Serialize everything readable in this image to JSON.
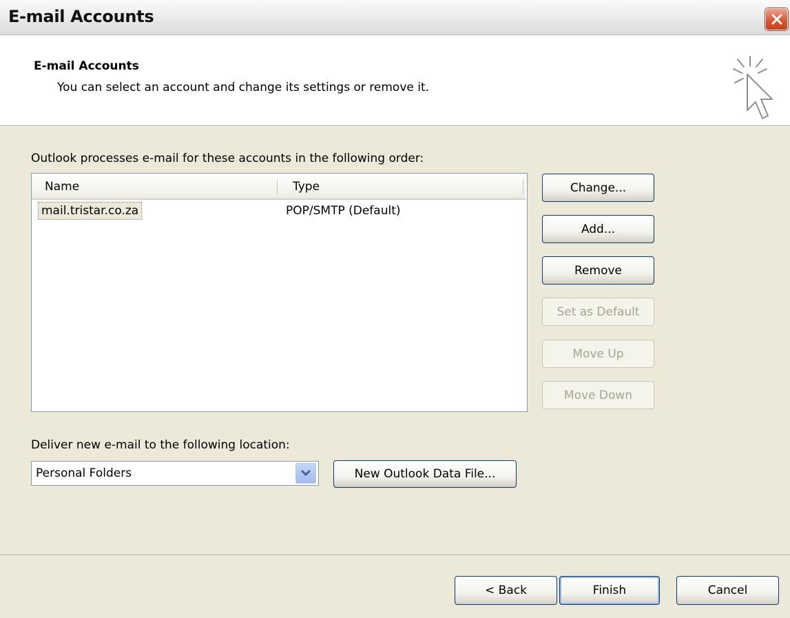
{
  "window": {
    "title": "E-mail Accounts"
  },
  "header": {
    "title": "E-mail Accounts",
    "subtitle": "You can select an account and change its settings or remove it."
  },
  "accounts_label": "Outlook processes e-mail for these accounts in the following order:",
  "accounts_list": {
    "columns": [
      "Name",
      "Type"
    ],
    "rows": [
      {
        "name": "mail.tristar.co.za",
        "type": "POP/SMTP (Default)",
        "selected": true
      }
    ]
  },
  "side_buttons": {
    "change": "Change...",
    "add": "Add...",
    "remove": "Remove",
    "set_default": "Set as Default",
    "move_up": "Move Up",
    "move_down": "Move Down"
  },
  "deliver": {
    "label": "Deliver new e-mail to the following location:",
    "selected": "Personal Folders",
    "new_file_button": "New Outlook Data File..."
  },
  "footer": {
    "back": "< Back",
    "finish": "Finish",
    "cancel": "Cancel"
  },
  "colors": {
    "dialog_bg": "#ece9d8",
    "button_border": "#003c74",
    "close_button": "#d9542f"
  }
}
